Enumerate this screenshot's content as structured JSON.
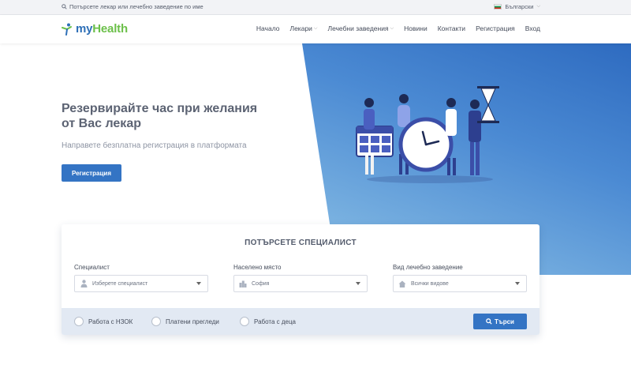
{
  "topbar": {
    "search_text": "Потърсете лекар или лечебно заведение по име",
    "language": "Български"
  },
  "header": {
    "logo_my": "my",
    "logo_health": "Health",
    "nav": [
      "Начало",
      "Лекари",
      "Лечебни заведения",
      "Новини",
      "Контакти",
      "Регистрация",
      "Вход"
    ]
  },
  "hero": {
    "title": "Резервирайте час при желания от Вас лекар",
    "subtitle": "Направете безплатна регистрация в платформата",
    "button": "Регистрация"
  },
  "search": {
    "title": "ПОТЪРСЕТЕ СПЕЦИАЛИСТ",
    "fields": [
      {
        "label": "Специалист",
        "value": "Изберете специалист",
        "icon": "doctor-icon"
      },
      {
        "label": "Населено място",
        "value": "София",
        "icon": "city-icon"
      },
      {
        "label": "Вид лечебно заведение",
        "value": "Всички видове",
        "icon": "house-icon"
      }
    ],
    "filters": [
      "Работа с НЗОК",
      "Платени прегледи",
      "Работа с деца"
    ],
    "button": "Търси"
  },
  "colors": {
    "primary": "#3474c4",
    "brand_green": "#6cc04a",
    "hero_blue": "#2e6bc0"
  }
}
